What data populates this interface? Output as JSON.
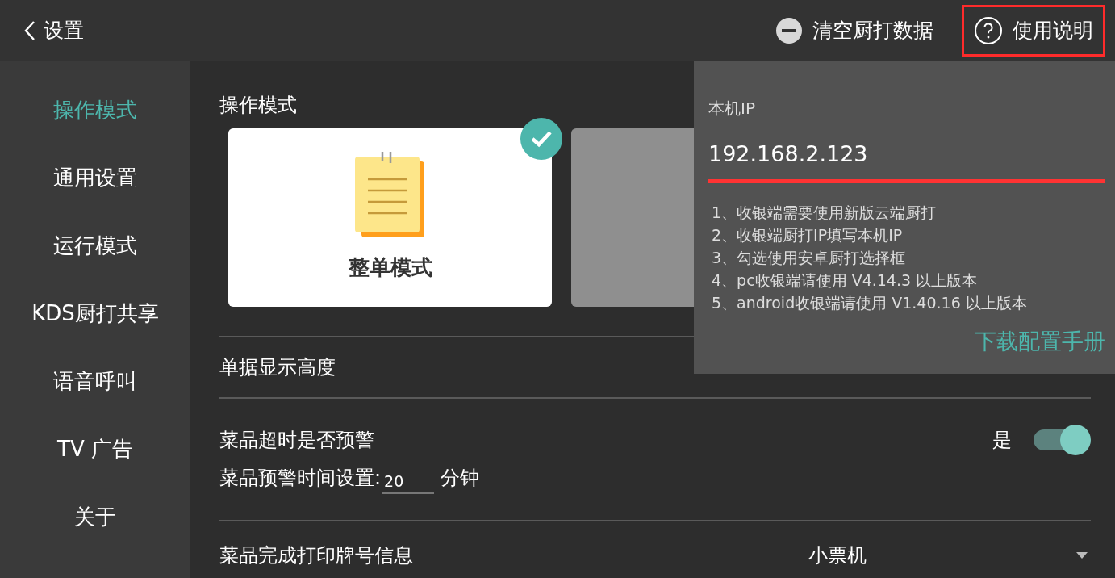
{
  "header": {
    "back_label": "设置",
    "actions": [
      {
        "kind": "clear",
        "label": "清空厨打数据",
        "highlighted": false
      },
      {
        "kind": "help",
        "label": "使用说明",
        "highlighted": true
      }
    ]
  },
  "sidebar": {
    "items": [
      {
        "label": "操作模式",
        "selected": true
      },
      {
        "label": "通用设置",
        "selected": false
      },
      {
        "label": "运行模式",
        "selected": false
      },
      {
        "label": "KDS厨打共享",
        "selected": false
      },
      {
        "label": "语音呼叫",
        "selected": false
      },
      {
        "label": "TV 广告",
        "selected": false
      },
      {
        "label": "关于",
        "selected": false
      }
    ]
  },
  "mode_section": {
    "title": "操作模式",
    "modes": [
      {
        "label": "整单模式",
        "selected": true
      },
      {
        "selected": false
      }
    ]
  },
  "display_height": {
    "label": "单据显示高度"
  },
  "warning": {
    "label": "菜品超时是否预警",
    "value_label": "是",
    "on": true,
    "time_label": "菜品预警时间设置:",
    "time_value": "20",
    "unit": "分钟"
  },
  "print_info": {
    "label": "菜品完成打印牌号信息",
    "value": "小票机"
  },
  "help_popup": {
    "ip_label": "本机IP",
    "ip_value": "192.168.2.123",
    "notes": [
      "1、收银端需要使用新版云端厨打",
      "2、收银端厨打IP填写本机IP",
      "3、勾选使用安卓厨打选择框",
      "4、pc收银端请使用 V4.14.3 以上版本",
      "5、android收银端请使用 V1.40.16 以上版本"
    ],
    "link": "下载配置手册"
  }
}
